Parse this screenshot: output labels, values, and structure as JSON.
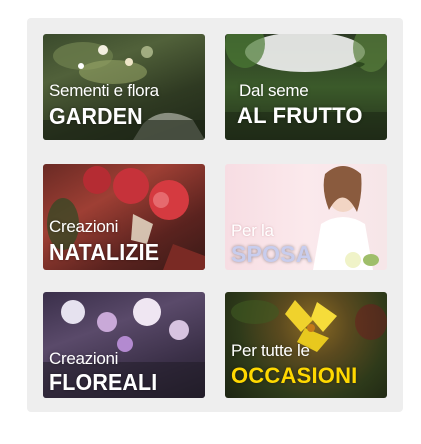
{
  "tiles": [
    {
      "id": "garden",
      "subtitle": "Sementi e flora",
      "title": "GARDEN"
    },
    {
      "id": "frutto",
      "subtitle": "Dal seme",
      "title": "AL FRUTTO"
    },
    {
      "id": "natalizie",
      "subtitle": "Creazioni",
      "title": "NATALIZIE"
    },
    {
      "id": "sposa",
      "subtitle": "Per la",
      "title": "SPOSA"
    },
    {
      "id": "floreali",
      "subtitle": "Creazioni",
      "title": "FLOREALI"
    },
    {
      "id": "occasioni",
      "subtitle": "Per tutte le",
      "title": "OCCASIONI"
    }
  ],
  "colors": {
    "panel": "#eeeeee",
    "accent_yellow": "#ffd800"
  }
}
